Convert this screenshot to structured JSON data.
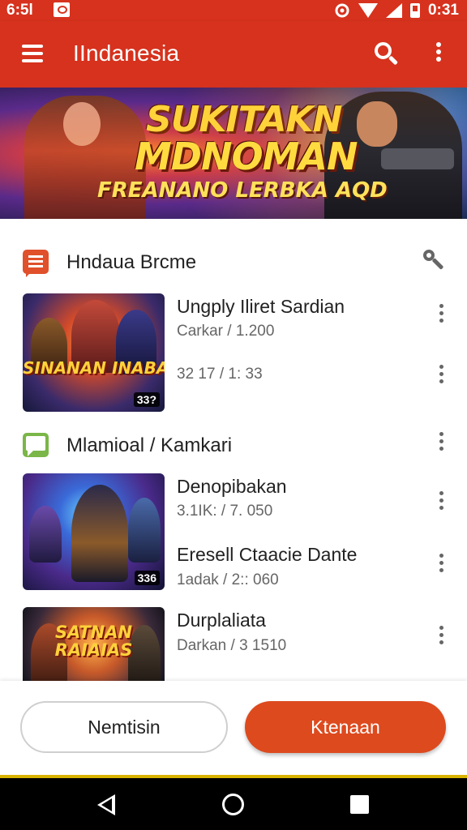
{
  "status_bar": {
    "time_left": "6:5l",
    "time_right": "0:31",
    "icons": [
      "image-icon",
      "signal-icon",
      "wifi-icon",
      "cell-icon",
      "battery-icon"
    ]
  },
  "app_bar": {
    "title": "IIndanesia",
    "icons": [
      "menu-icon",
      "search-icon",
      "overflow-icon"
    ],
    "background": "#d6321e"
  },
  "banner": {
    "line1": "SUKITAKN",
    "line2": "MDNOMAN",
    "line3": "FREANANO LERBKA AQD"
  },
  "sections": [
    {
      "title": "Hndaua Brcme",
      "icon": "list-icon",
      "action_icon": "wrench-icon",
      "items": [
        {
          "title": "Ungply Iliret Sardian",
          "sub1": "Carkar / 1.200",
          "sub2": "32 17 / 1: 33",
          "thumb_caption": "SINANAN INABASIN",
          "badge": "33?"
        }
      ]
    },
    {
      "title": "Mlamioal / Kamkari",
      "icon": "chat-icon",
      "action_icon": "kebab-icon",
      "items": [
        {
          "title": "Denopibakan",
          "sub": "3.1IK: / 7. 050",
          "badge": "336"
        },
        {
          "title": "Eresell Ctaacie Dante",
          "sub": "1adak / 2:: 060"
        },
        {
          "title": "Durplaliata",
          "sub": "Darkan / 3 1510",
          "thumb_caption": "SATNAN RAIAIAS"
        }
      ]
    }
  ],
  "actions": {
    "secondary": "Nemtisin",
    "primary": "Ktenaan",
    "primary_color": "#dd4a1e"
  },
  "nav_bar": {
    "icons": [
      "back-icon",
      "home-icon",
      "recents-icon"
    ]
  }
}
